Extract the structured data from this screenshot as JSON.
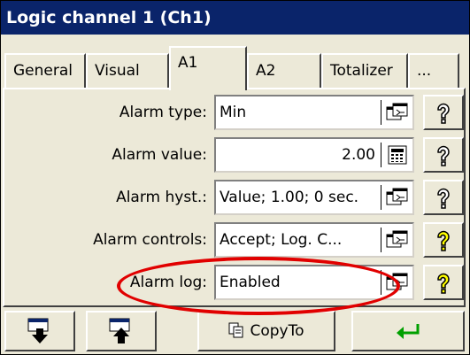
{
  "window": {
    "title": "Logic channel 1 (Ch1)"
  },
  "tabs": [
    {
      "label": "General"
    },
    {
      "label": "Visual"
    },
    {
      "label": "A1"
    },
    {
      "label": "A2"
    },
    {
      "label": "Totalizer"
    },
    {
      "label": "..."
    }
  ],
  "active_tab": "A1",
  "form": {
    "rows": [
      {
        "label": "Alarm type:",
        "value": "Min",
        "icon": "settings-dialog-icon"
      },
      {
        "label": "Alarm value:",
        "value": "2.00",
        "icon": "calculator-icon"
      },
      {
        "label": "Alarm hyst.:",
        "value": "Value; 1.00; 0 sec.",
        "icon": "settings-dialog-icon"
      },
      {
        "label": "Alarm controls:",
        "value": "Accept; Log. C...",
        "icon": "settings-dialog-icon"
      },
      {
        "label": "Alarm log:",
        "value": "Enabled",
        "icon": "settings-dialog-icon"
      }
    ]
  },
  "bottom": {
    "copyto_label": "CopyTo"
  },
  "colors": {
    "titlebar": "#0a246a",
    "highlight": "#e10000",
    "enter_arrow": "#00a000",
    "help_yellow": "#ffff00"
  }
}
